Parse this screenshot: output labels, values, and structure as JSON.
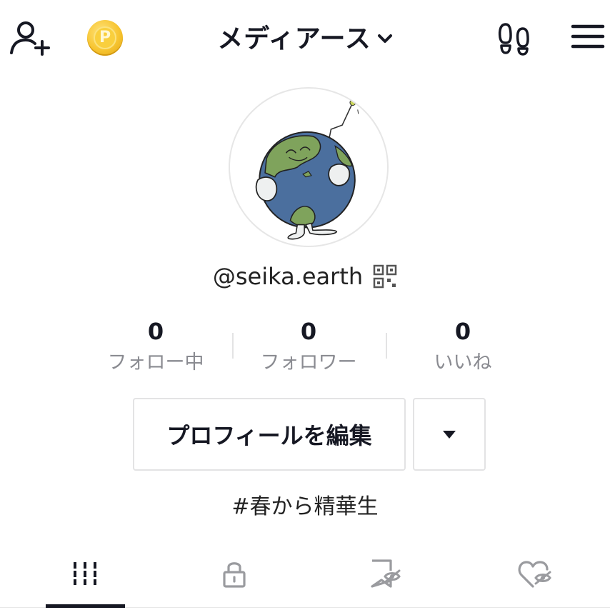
{
  "header": {
    "title": "メディアース",
    "coin_letter": "P",
    "icons": [
      "add-user-icon",
      "coin-icon",
      "chevron-down-icon",
      "footprints-icon",
      "menu-icon"
    ]
  },
  "profile": {
    "avatar_description_icon": "earth-character-avatar",
    "handle": "@seika.earth",
    "qr_icon": "qr-code-icon",
    "bio": "#春から精華生"
  },
  "stats": [
    {
      "value": "0",
      "label": "フォロー中"
    },
    {
      "value": "0",
      "label": "フォロワー"
    },
    {
      "value": "0",
      "label": "いいね"
    }
  ],
  "actions": {
    "edit_profile_label": "プロフィールを編集",
    "more_icon": "dropdown-triangle-icon"
  },
  "tabs": [
    {
      "icon": "grid-icon",
      "active": true
    },
    {
      "icon": "lock-icon",
      "active": false
    },
    {
      "icon": "bookmark-hidden-icon",
      "active": false
    },
    {
      "icon": "heart-hidden-icon",
      "active": false
    }
  ],
  "colors": {
    "text": "#161823",
    "muted": "#8a8b91",
    "border": "#e3e3e4",
    "ocean": "#4b6f9e",
    "land": "#7fa35c",
    "coin": "#f7c531"
  }
}
